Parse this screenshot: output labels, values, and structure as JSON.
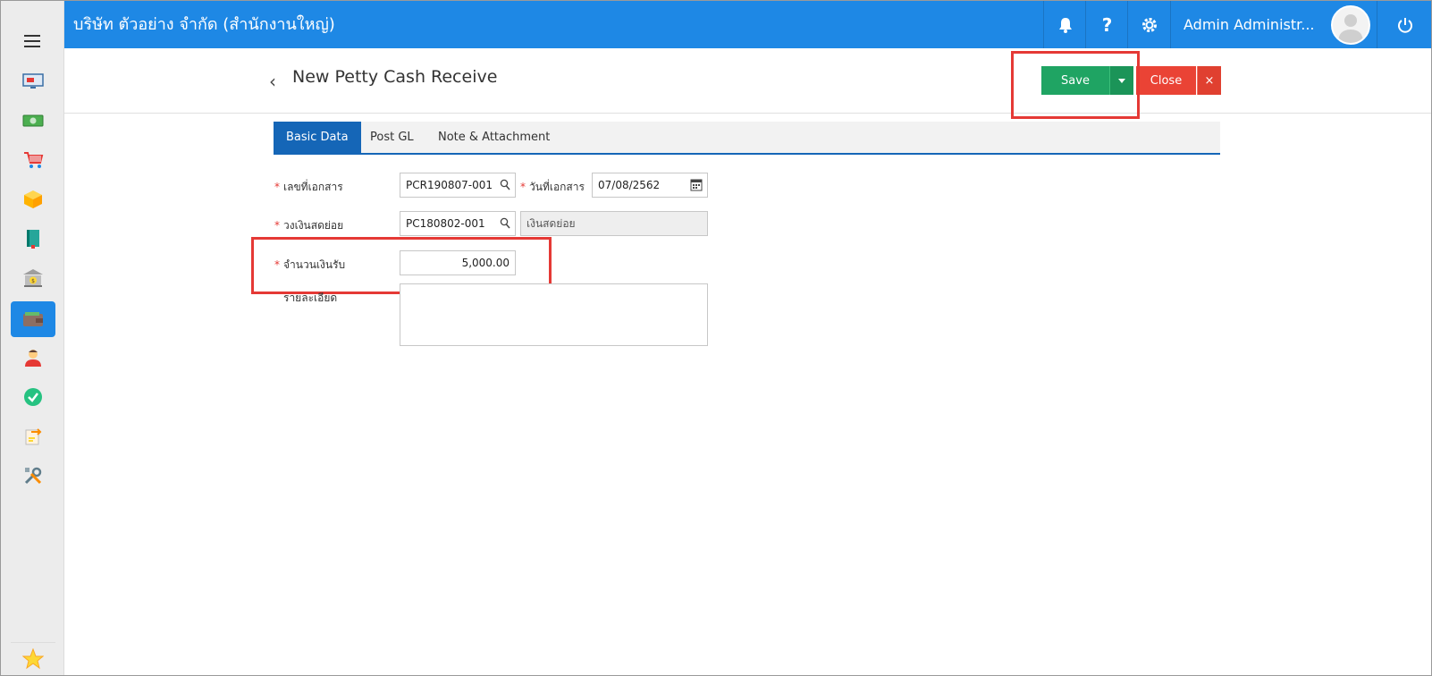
{
  "topbar": {
    "company": "บริษัท ตัวอย่าง จำกัด (สำนักงานใหญ่)",
    "user_name": "Admin Administr...",
    "icons": [
      "bell-icon",
      "help-icon",
      "gear-icon",
      "power-icon"
    ]
  },
  "sidebar": {
    "items": [
      "dashboard-icon",
      "money-icon",
      "cart-icon",
      "box-icon",
      "book-icon",
      "bank-icon",
      "wallet-icon",
      "person-icon",
      "check-icon",
      "transfer-icon",
      "tools-icon"
    ],
    "active": "wallet-icon",
    "favorite": "star-icon"
  },
  "page": {
    "back": "‹",
    "title": "New Petty Cash Receive"
  },
  "actions": {
    "save_label": "Save",
    "close_label": "Close",
    "close_x": "×"
  },
  "tabs": [
    "Basic Data",
    "Post GL",
    "Note & Attachment"
  ],
  "form": {
    "doc_no_label": "เลขที่เอกสาร",
    "doc_no_value": "PCR190807-001",
    "doc_date_label": "วันที่เอกสาร",
    "doc_date_value": "07/08/2562",
    "petty_cash_label": "วงเงินสดย่อย",
    "petty_cash_value": "PC180802-001",
    "petty_cash_name": "เงินสดย่อย",
    "amount_label": "จำนวนเงินรับ",
    "amount_value": "5,000.00",
    "detail_label": "รายละเอียด",
    "detail_value": "",
    "required_mark": "*"
  },
  "colors": {
    "topbar": "#1e88e5",
    "save": "#1fa463",
    "close": "#ea4335",
    "tab_active": "#1566b7",
    "highlight": "#e53935"
  }
}
